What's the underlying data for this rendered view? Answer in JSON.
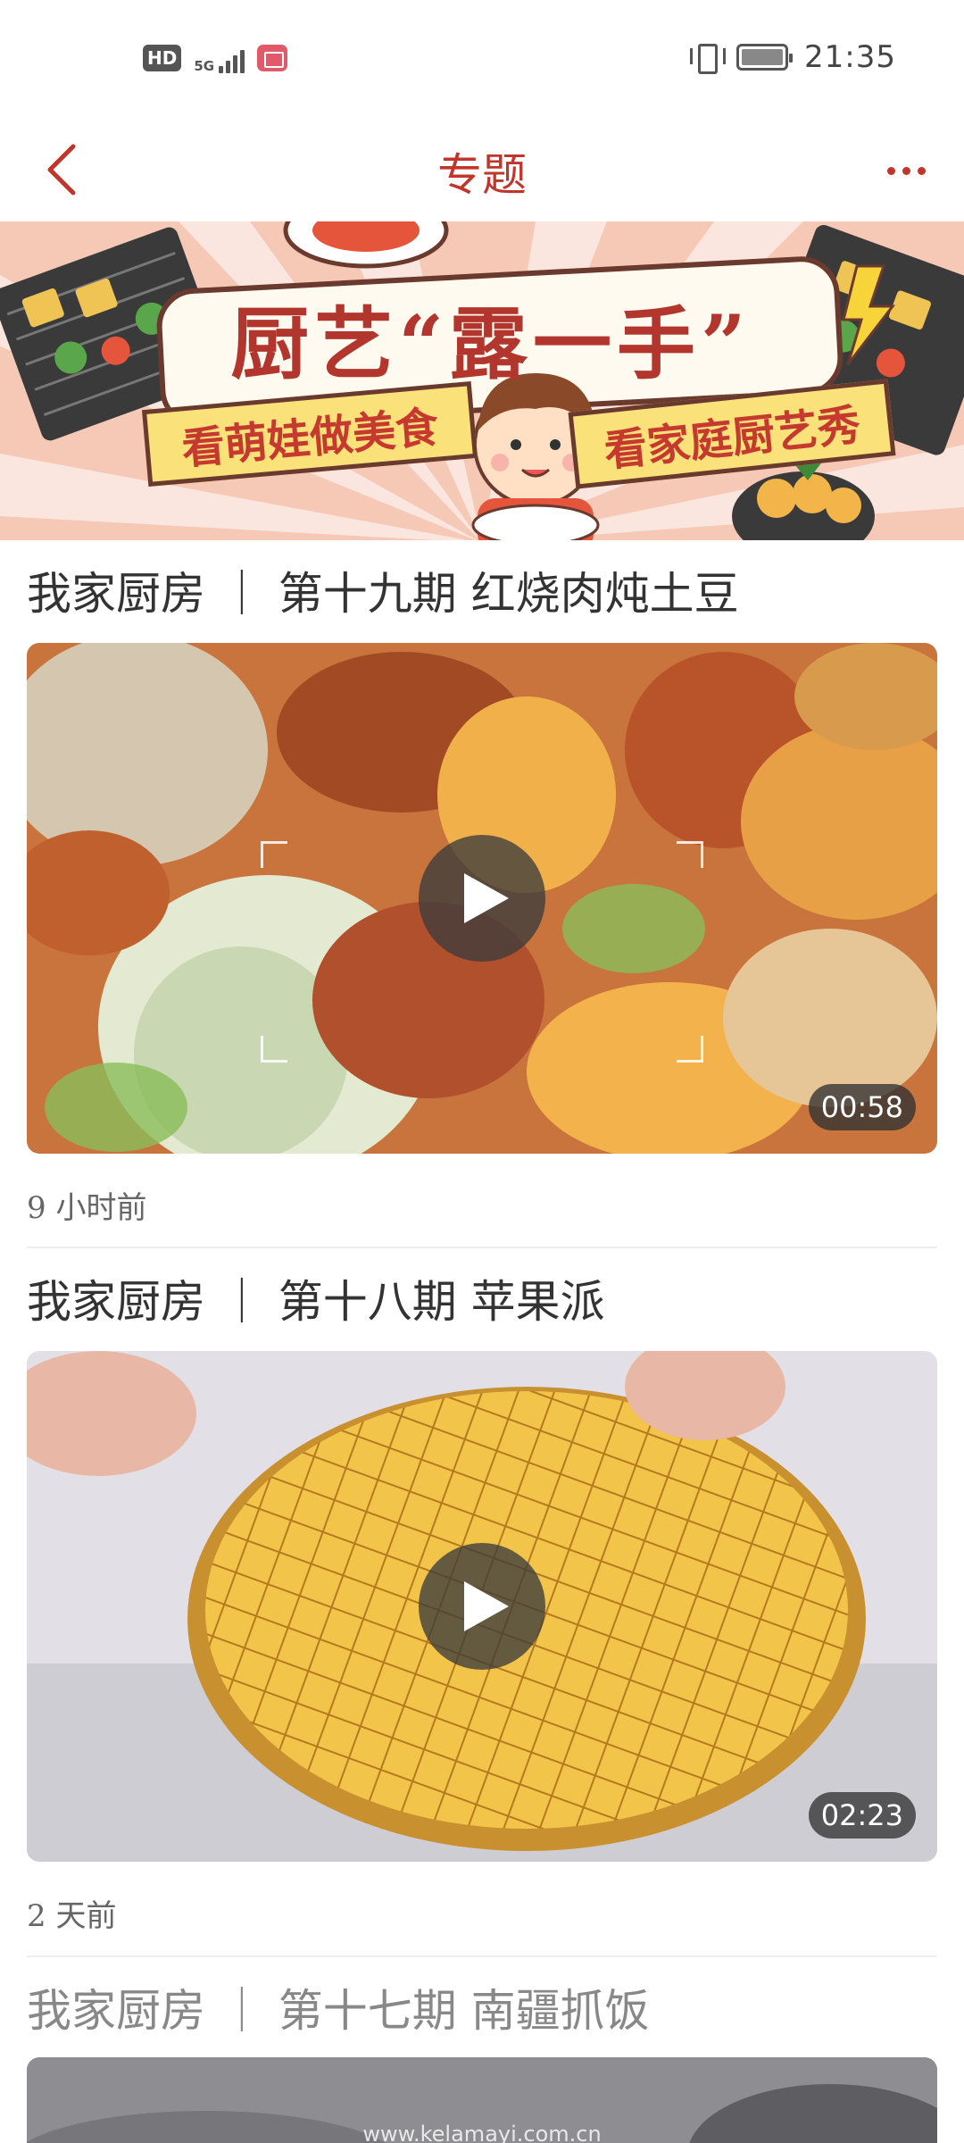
{
  "status_bar": {
    "hd": "HD",
    "network": "5G",
    "time": "21:35"
  },
  "header": {
    "title": "专题"
  },
  "banner": {
    "title": "厨艺“露一手”",
    "left_tag": "看萌娃做美食",
    "right_tag": "看家庭厨艺秀"
  },
  "items": [
    {
      "title": "我家厨房 ｜ 第十九期 红烧肉炖土豆",
      "duration": "00:58",
      "time_ago": "9 小时前"
    },
    {
      "title": "我家厨房 ｜ 第十八期 苹果派",
      "duration": "02:23",
      "time_ago": "2 天前"
    },
    {
      "title": "我家厨房 ｜ 第十七期 南疆抓饭",
      "watermark": "www.kelamayi.com.cn"
    }
  ],
  "colors": {
    "accent": "#c2352b",
    "banner_bg": "#f6c8b6"
  }
}
